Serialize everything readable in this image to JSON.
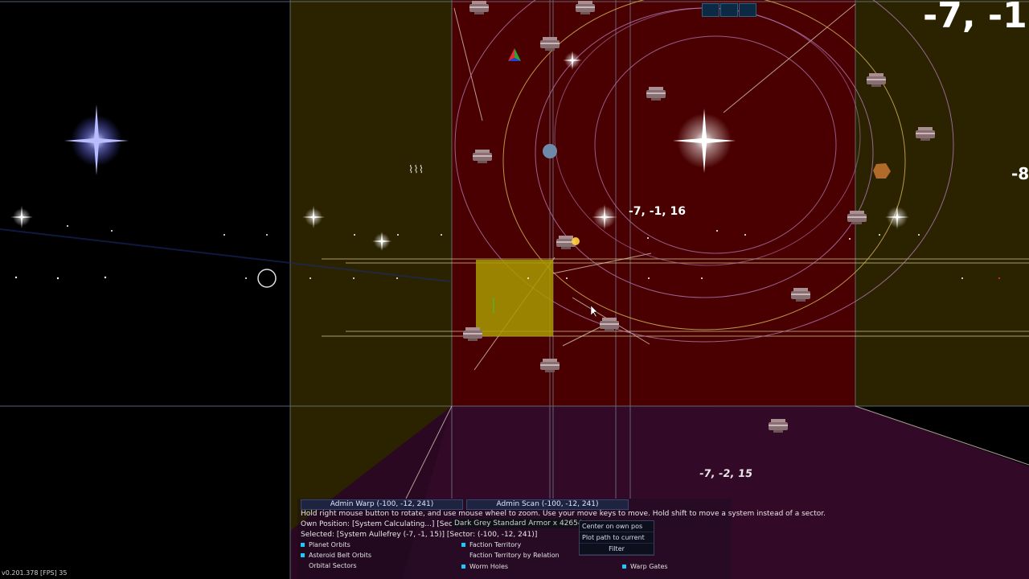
{
  "sector_labels": {
    "top_right": "-7, -1",
    "center": "-7, -1, 16",
    "right_edge": "-8",
    "bottom": "-7, -2, 15"
  },
  "panel": {
    "admin_warp": "Admin Warp (-100, -12, 241)",
    "admin_scan": "Admin Scan (-100, -12, 241)",
    "help_text": "Hold right mouse button to rotate, and use mouse wheel to zoom. Use your move keys to move. Hold shift to move a system instead of a sector.",
    "own_position": "Own Position: [System Calculating...] [Sector: (-99, -",
    "tooltip_item": "Dark Grey Standard Armor x 42654",
    "selected": "Selected: [System Aullefrey (-7, -1, 15)] [Sector: (-100, -12, 241)]"
  },
  "context_menu": {
    "center_on_own_pos": "Center on own pos",
    "plot_path": "Plot path to current",
    "filter": "Filter"
  },
  "filters": [
    {
      "label": "Planet Orbits",
      "checked": true
    },
    {
      "label": "Asteroid Belt Orbits",
      "checked": true
    },
    {
      "label": "Orbital Sectors",
      "checked": false
    },
    {
      "label": "Faction Territory",
      "checked": true
    },
    {
      "label": "Faction Territory by Relation",
      "checked": false
    },
    {
      "label": "Worm Holes",
      "checked": true
    },
    {
      "label": "Warp Gates",
      "checked": true
    }
  ],
  "status": {
    "version_fps": "v0.201.378   [FPS] 35"
  },
  "colors": {
    "sector_red": "#4a0000",
    "sector_olive": "#2b2300",
    "sector_purple": "#2a0822",
    "selected_yellow": "#a89a00",
    "check_cyan": "#1ec8ff"
  },
  "icons": [
    "map-tool-icon",
    "message-icon",
    "chart-icon",
    "waypoint-marker-icon"
  ]
}
